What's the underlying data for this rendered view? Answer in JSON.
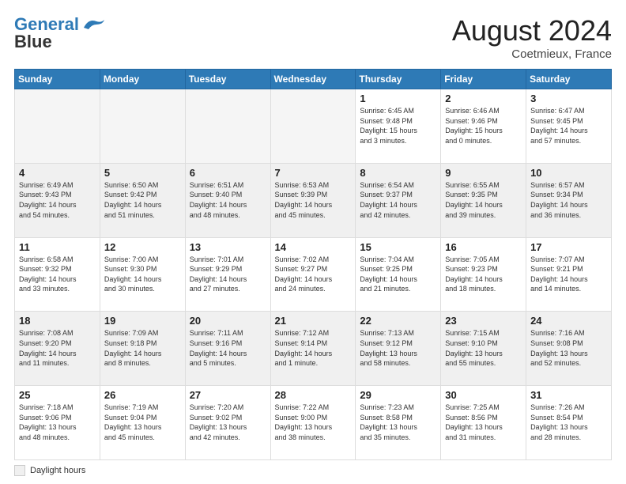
{
  "header": {
    "logo_line1": "General",
    "logo_line2": "Blue",
    "month_title": "August 2024",
    "location": "Coetmieux, France"
  },
  "footer": {
    "label": "Daylight hours"
  },
  "days_of_week": [
    "Sunday",
    "Monday",
    "Tuesday",
    "Wednesday",
    "Thursday",
    "Friday",
    "Saturday"
  ],
  "weeks": [
    [
      {
        "day": "",
        "info": "",
        "empty": true
      },
      {
        "day": "",
        "info": "",
        "empty": true
      },
      {
        "day": "",
        "info": "",
        "empty": true
      },
      {
        "day": "",
        "info": "",
        "empty": true
      },
      {
        "day": "1",
        "info": "Sunrise: 6:45 AM\nSunset: 9:48 PM\nDaylight: 15 hours\nand 3 minutes."
      },
      {
        "day": "2",
        "info": "Sunrise: 6:46 AM\nSunset: 9:46 PM\nDaylight: 15 hours\nand 0 minutes."
      },
      {
        "day": "3",
        "info": "Sunrise: 6:47 AM\nSunset: 9:45 PM\nDaylight: 14 hours\nand 57 minutes."
      }
    ],
    [
      {
        "day": "4",
        "info": "Sunrise: 6:49 AM\nSunset: 9:43 PM\nDaylight: 14 hours\nand 54 minutes."
      },
      {
        "day": "5",
        "info": "Sunrise: 6:50 AM\nSunset: 9:42 PM\nDaylight: 14 hours\nand 51 minutes."
      },
      {
        "day": "6",
        "info": "Sunrise: 6:51 AM\nSunset: 9:40 PM\nDaylight: 14 hours\nand 48 minutes."
      },
      {
        "day": "7",
        "info": "Sunrise: 6:53 AM\nSunset: 9:39 PM\nDaylight: 14 hours\nand 45 minutes."
      },
      {
        "day": "8",
        "info": "Sunrise: 6:54 AM\nSunset: 9:37 PM\nDaylight: 14 hours\nand 42 minutes."
      },
      {
        "day": "9",
        "info": "Sunrise: 6:55 AM\nSunset: 9:35 PM\nDaylight: 14 hours\nand 39 minutes."
      },
      {
        "day": "10",
        "info": "Sunrise: 6:57 AM\nSunset: 9:34 PM\nDaylight: 14 hours\nand 36 minutes."
      }
    ],
    [
      {
        "day": "11",
        "info": "Sunrise: 6:58 AM\nSunset: 9:32 PM\nDaylight: 14 hours\nand 33 minutes."
      },
      {
        "day": "12",
        "info": "Sunrise: 7:00 AM\nSunset: 9:30 PM\nDaylight: 14 hours\nand 30 minutes."
      },
      {
        "day": "13",
        "info": "Sunrise: 7:01 AM\nSunset: 9:29 PM\nDaylight: 14 hours\nand 27 minutes."
      },
      {
        "day": "14",
        "info": "Sunrise: 7:02 AM\nSunset: 9:27 PM\nDaylight: 14 hours\nand 24 minutes."
      },
      {
        "day": "15",
        "info": "Sunrise: 7:04 AM\nSunset: 9:25 PM\nDaylight: 14 hours\nand 21 minutes."
      },
      {
        "day": "16",
        "info": "Sunrise: 7:05 AM\nSunset: 9:23 PM\nDaylight: 14 hours\nand 18 minutes."
      },
      {
        "day": "17",
        "info": "Sunrise: 7:07 AM\nSunset: 9:21 PM\nDaylight: 14 hours\nand 14 minutes."
      }
    ],
    [
      {
        "day": "18",
        "info": "Sunrise: 7:08 AM\nSunset: 9:20 PM\nDaylight: 14 hours\nand 11 minutes."
      },
      {
        "day": "19",
        "info": "Sunrise: 7:09 AM\nSunset: 9:18 PM\nDaylight: 14 hours\nand 8 minutes."
      },
      {
        "day": "20",
        "info": "Sunrise: 7:11 AM\nSunset: 9:16 PM\nDaylight: 14 hours\nand 5 minutes."
      },
      {
        "day": "21",
        "info": "Sunrise: 7:12 AM\nSunset: 9:14 PM\nDaylight: 14 hours\nand 1 minute."
      },
      {
        "day": "22",
        "info": "Sunrise: 7:13 AM\nSunset: 9:12 PM\nDaylight: 13 hours\nand 58 minutes."
      },
      {
        "day": "23",
        "info": "Sunrise: 7:15 AM\nSunset: 9:10 PM\nDaylight: 13 hours\nand 55 minutes."
      },
      {
        "day": "24",
        "info": "Sunrise: 7:16 AM\nSunset: 9:08 PM\nDaylight: 13 hours\nand 52 minutes."
      }
    ],
    [
      {
        "day": "25",
        "info": "Sunrise: 7:18 AM\nSunset: 9:06 PM\nDaylight: 13 hours\nand 48 minutes."
      },
      {
        "day": "26",
        "info": "Sunrise: 7:19 AM\nSunset: 9:04 PM\nDaylight: 13 hours\nand 45 minutes."
      },
      {
        "day": "27",
        "info": "Sunrise: 7:20 AM\nSunset: 9:02 PM\nDaylight: 13 hours\nand 42 minutes."
      },
      {
        "day": "28",
        "info": "Sunrise: 7:22 AM\nSunset: 9:00 PM\nDaylight: 13 hours\nand 38 minutes."
      },
      {
        "day": "29",
        "info": "Sunrise: 7:23 AM\nSunset: 8:58 PM\nDaylight: 13 hours\nand 35 minutes."
      },
      {
        "day": "30",
        "info": "Sunrise: 7:25 AM\nSunset: 8:56 PM\nDaylight: 13 hours\nand 31 minutes."
      },
      {
        "day": "31",
        "info": "Sunrise: 7:26 AM\nSunset: 8:54 PM\nDaylight: 13 hours\nand 28 minutes."
      }
    ]
  ]
}
